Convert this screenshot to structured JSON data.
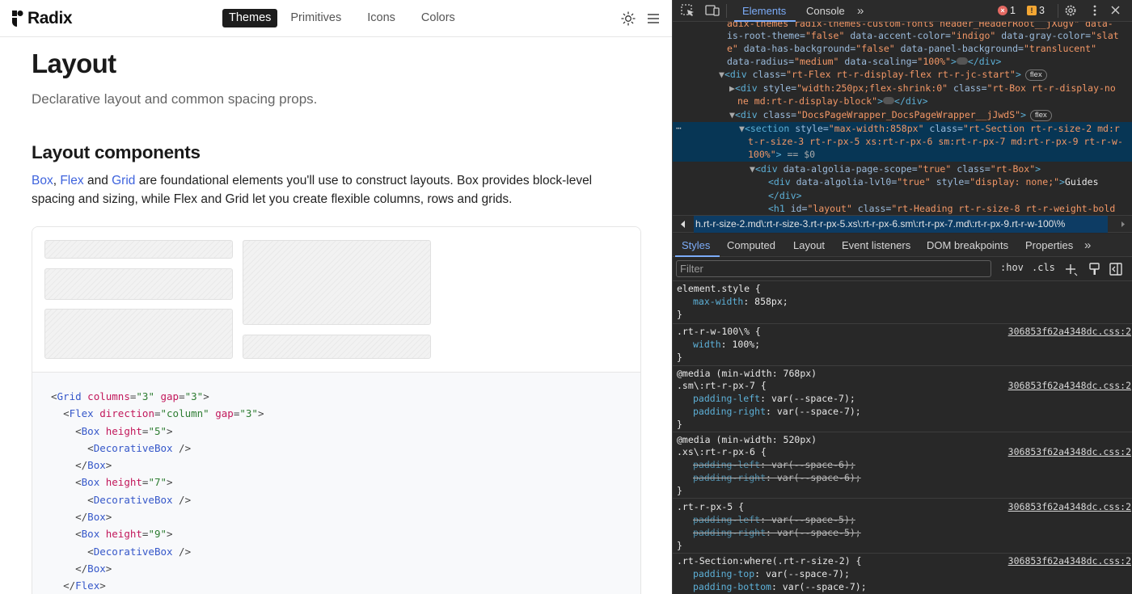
{
  "nav": {
    "logo_text": "Radix",
    "links": [
      "Themes",
      "Primitives",
      "Icons",
      "Colors"
    ]
  },
  "page": {
    "title": "Layout",
    "subtitle": "Declarative layout and common spacing props.",
    "section_title": "Layout components",
    "intro": {
      "link1": "Box",
      "sep1": ", ",
      "link2": "Flex",
      "sep2": " and ",
      "link3": "Grid",
      "rest": " are foundational elements you'll use to construct layouts. Box provides block-level spacing and sizing, while Flex and Grid let you create flexible columns, rows and grids."
    }
  },
  "code": [
    {
      "indent": 0,
      "open": "<",
      "tag": "Grid",
      "attrs": [
        [
          "columns",
          "\"3\""
        ],
        [
          "gap",
          "\"3\""
        ]
      ],
      "close": ">"
    },
    {
      "indent": 1,
      "open": "<",
      "tag": "Flex",
      "attrs": [
        [
          "direction",
          "\"column\""
        ],
        [
          "gap",
          "\"3\""
        ]
      ],
      "close": ">"
    },
    {
      "indent": 2,
      "open": "<",
      "tag": "Box",
      "attrs": [
        [
          "height",
          "\"5\""
        ]
      ],
      "close": ">"
    },
    {
      "indent": 3,
      "open": "<",
      "tag": "DecorativeBox",
      "attrs": [],
      "close": " />"
    },
    {
      "indent": 2,
      "open": "</",
      "tag": "Box",
      "attrs": [],
      "close": ">"
    },
    {
      "indent": 2,
      "open": "<",
      "tag": "Box",
      "attrs": [
        [
          "height",
          "\"7\""
        ]
      ],
      "close": ">"
    },
    {
      "indent": 3,
      "open": "<",
      "tag": "DecorativeBox",
      "attrs": [],
      "close": " />"
    },
    {
      "indent": 2,
      "open": "</",
      "tag": "Box",
      "attrs": [],
      "close": ">"
    },
    {
      "indent": 2,
      "open": "<",
      "tag": "Box",
      "attrs": [
        [
          "height",
          "\"9\""
        ]
      ],
      "close": ">"
    },
    {
      "indent": 3,
      "open": "<",
      "tag": "DecorativeBox",
      "attrs": [],
      "close": " />"
    },
    {
      "indent": 2,
      "open": "</",
      "tag": "Box",
      "attrs": [],
      "close": ">"
    },
    {
      "indent": 1,
      "open": "</",
      "tag": "Flex",
      "attrs": [],
      "close": ">"
    }
  ],
  "devtools": {
    "tabs": [
      "Elements",
      "Console"
    ],
    "error_count": "1",
    "warning_count": "3",
    "dom": {
      "l0": "adix-themes radix-themes-custom-fonts header_HeaderRoot__jXugV\" data-",
      "l1a": "is-root-theme=",
      "l1b": "\"false\"",
      "l1c": " data-accent-color=",
      "l1d": "\"indigo\"",
      "l1e": " data-gray-color=",
      "l1f": "\"slat",
      "l2a": "e\"",
      "l2b": " data-has-background=",
      "l2c": "\"false\"",
      "l2d": " data-panel-background=",
      "l2e": "\"translucent\"",
      "l3a": "data-radius=",
      "l3b": "\"medium\"",
      "l3c": " data-scaling=",
      "l3d": "\"100%\"",
      "l4": "\"rt-Flex rt-r-display-flex rt-r-jc-start\"",
      "l5a": "\"width:250px;flex-shrink:0\"",
      "l5b": "\"rt-Box rt-r-display-no",
      "l6": "ne md:rt-r-display-block\"",
      "l7": "\"DocsPageWrapper_DocsPageWrapper__jJwdS\"",
      "l8a": "\"max-width:858px\"",
      "l8b": "\"rt-Section rt-r-size-2 md:r",
      "l9": "t-r-size-3 rt-r-px-5 xs:rt-r-px-6 sm:rt-r-px-7 md:rt-r-px-9 rt-r-w-",
      "l10": "100%\"",
      "l10b": " == $0",
      "l11a": "\"true\"",
      "l11b": "\"rt-Box\"",
      "l12a": "\"true\"",
      "l12b": "\"display: none;\"",
      "l12c": "Guides",
      "l14a": "\"layout\"",
      "l14b": "\"rt-Heading rt-r-size-8 rt-r-weight-bold",
      "flex_pill": "flex"
    },
    "breadcrumb": "h.rt-r-size-2.md\\:rt-r-size-3.rt-r-px-5.xs\\:rt-r-px-6.sm\\:rt-r-px-7.md\\:rt-r-px-9.rt-r-w-100\\%",
    "subtabs": [
      "Styles",
      "Computed",
      "Layout",
      "Event listeners",
      "DOM breakpoints",
      "Properties"
    ],
    "filter_placeholder": "Filter",
    "hov": ":hov",
    "cls": ".cls",
    "source_file": "306853f62a4348dc.css:2",
    "rules": {
      "r1_sel": "element.style {",
      "r1_p": "max-width",
      "r1_v": ": 858px;",
      "r2_sel": ".rt-r-w-100\\% {",
      "r2_p": "width",
      "r2_v": ": 100%;",
      "r3_media": "@media (min-width: 768px)",
      "r3_sel": ".sm\\:rt-r-px-7 {",
      "r3_p1": "padding-left",
      "r3_v1": ": var(--space-7);",
      "r3_p2": "padding-right",
      "r3_v2": ": var(--space-7);",
      "r4_media": "@media (min-width: 520px)",
      "r4_sel": ".xs\\:rt-r-px-6 {",
      "r4_p1": "padding-left",
      "r4_v1": ": var(--space-6);",
      "r4_p2": "padding-right",
      "r4_v2": ": var(--space-6);",
      "r5_sel": ".rt-r-px-5 {",
      "r5_p1": "padding-left",
      "r5_v1": ": var(--space-5);",
      "r5_p2": "padding-right",
      "r5_v2": ": var(--space-5);",
      "r6_sel": ".rt-Section:where(.rt-r-size-2) {",
      "r6_p1": "padding-top",
      "r6_v1": ": var(--space-7);",
      "r6_p2": "padding-bottom",
      "r6_v2": ": var(--space-7);",
      "close": "}"
    }
  }
}
